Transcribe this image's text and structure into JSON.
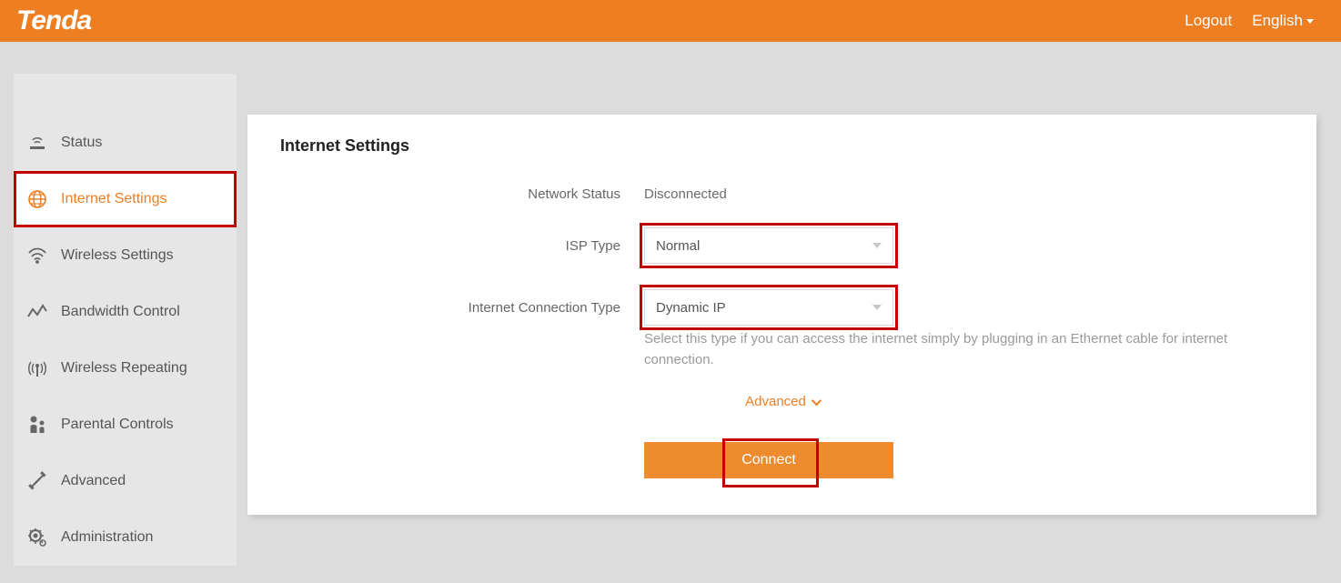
{
  "brand": "Tenda",
  "header": {
    "logout": "Logout",
    "language": "English"
  },
  "sidebar": {
    "items": [
      {
        "label": "Status"
      },
      {
        "label": "Internet Settings"
      },
      {
        "label": "Wireless Settings"
      },
      {
        "label": "Bandwidth Control"
      },
      {
        "label": "Wireless Repeating"
      },
      {
        "label": "Parental Controls"
      },
      {
        "label": "Advanced"
      },
      {
        "label": "Administration"
      }
    ]
  },
  "panel": {
    "title": "Internet Settings",
    "rows": {
      "network_status_label": "Network Status",
      "network_status_value": "Disconnected",
      "isp_type_label": "ISP Type",
      "isp_type_value": "Normal",
      "conn_type_label": "Internet Connection Type",
      "conn_type_value": "Dynamic IP",
      "help_text": "Select this type if you can access the internet simply by plugging in an Ethernet cable for internet connection."
    },
    "advanced_label": "Advanced",
    "connect_label": "Connect"
  }
}
